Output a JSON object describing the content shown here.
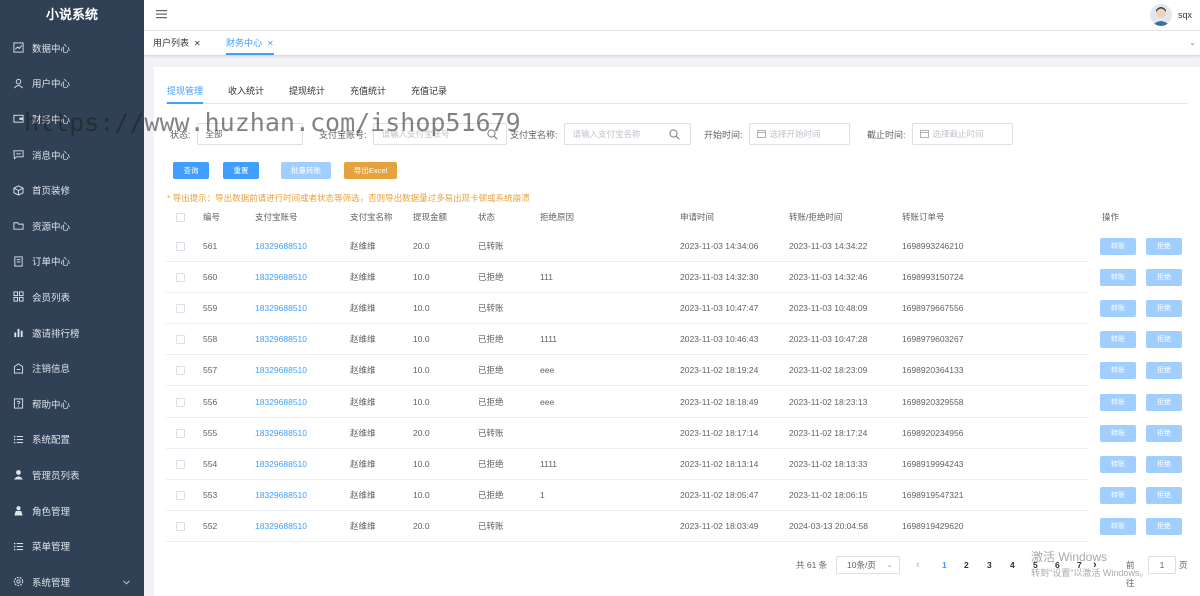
{
  "app_title": "小说系统",
  "sidebar": {
    "items": [
      {
        "label": "数据中心",
        "icon": "chart-icon"
      },
      {
        "label": "用户中心",
        "icon": "user-icon"
      },
      {
        "label": "财务中心",
        "icon": "wallet-icon"
      },
      {
        "label": "消息中心",
        "icon": "message-icon"
      },
      {
        "label": "首页装修",
        "icon": "cube-icon"
      },
      {
        "label": "资源中心",
        "icon": "folder-icon"
      },
      {
        "label": "订单中心",
        "icon": "order-icon"
      },
      {
        "label": "会员列表",
        "icon": "grid-icon"
      },
      {
        "label": "邀请排行榜",
        "icon": "bar-chart-icon"
      },
      {
        "label": "注销信息",
        "icon": "logout-icon"
      },
      {
        "label": "帮助中心",
        "icon": "help-icon"
      },
      {
        "label": "系统配置",
        "icon": "list-icon"
      },
      {
        "label": "管理员列表",
        "icon": "admin-icon"
      },
      {
        "label": "角色管理",
        "icon": "role-icon"
      },
      {
        "label": "菜单管理",
        "icon": "menu-icon"
      },
      {
        "label": "系统管理",
        "icon": "settings-icon"
      }
    ]
  },
  "header": {
    "username": "sqx"
  },
  "tags": [
    {
      "label": "用户列表",
      "active": false
    },
    {
      "label": "财务中心",
      "active": true
    }
  ],
  "tabs": [
    "提现管理",
    "收入统计",
    "提现统计",
    "充值统计",
    "充值记录"
  ],
  "filters": {
    "status_label": "状态:",
    "status_value": "全部",
    "account_label": "支付宝账号:",
    "account_placeholder": "请输入支付宝账号",
    "name_label": "支付宝名称:",
    "name_placeholder": "请输入支付宝名称",
    "start_label": "开始时间:",
    "start_placeholder": "选择开始时间",
    "end_label": "截止时间:",
    "end_placeholder": "选择截止时间"
  },
  "buttons": {
    "query": "查询",
    "reset": "重置",
    "batch": "批量转账",
    "export": "导出Excel"
  },
  "warning": "* 导出提示：导出数据前请进行时间或者状态等筛选，否则导出数据量过多易出现卡顿或系统崩溃",
  "table": {
    "headers": [
      "编号",
      "支付宝账号",
      "支付宝名称",
      "提现金额",
      "状态",
      "拒绝原因",
      "申请时间",
      "转账/拒绝时间",
      "转账订单号",
      "操作"
    ],
    "op_transfer": "转账",
    "op_reject": "拒绝",
    "rows": [
      [
        "561",
        "18329688510",
        "赵维维",
        "20.0",
        "已转账",
        "",
        "2023-11-03 14:34:06",
        "2023-11-03 14:34:22",
        "1698993246210"
      ],
      [
        "560",
        "18329688510",
        "赵维维",
        "10.0",
        "已拒绝",
        "111",
        "2023-11-03 14:32:30",
        "2023-11-03 14:32:46",
        "1698993150724"
      ],
      [
        "559",
        "18329688510",
        "赵维维",
        "10.0",
        "已转账",
        "",
        "2023-11-03 10:47:47",
        "2023-11-03 10:48:09",
        "1698979667556"
      ],
      [
        "558",
        "18329688510",
        "赵维维",
        "10.0",
        "已拒绝",
        "1111",
        "2023-11-03 10:46:43",
        "2023-11-03 10:47:28",
        "1698979603267"
      ],
      [
        "557",
        "18329688510",
        "赵维维",
        "10.0",
        "已拒绝",
        "eee",
        "2023-11-02 18:19:24",
        "2023-11-02 18:23:09",
        "1698920364133"
      ],
      [
        "556",
        "18329688510",
        "赵维维",
        "10.0",
        "已拒绝",
        "eee",
        "2023-11-02 18:18:49",
        "2023-11-02 18:23:13",
        "1698920329558"
      ],
      [
        "555",
        "18329688510",
        "赵维维",
        "20.0",
        "已转账",
        "",
        "2023-11-02 18:17:14",
        "2023-11-02 18:17:24",
        "1698920234956"
      ],
      [
        "554",
        "18329688510",
        "赵维维",
        "10.0",
        "已拒绝",
        "1111",
        "2023-11-02 18:13:14",
        "2023-11-02 18:13:33",
        "1698919994243"
      ],
      [
        "553",
        "18329688510",
        "赵维维",
        "10.0",
        "已拒绝",
        "1",
        "2023-11-02 18:05:47",
        "2023-11-02 18:06:15",
        "1698919547321"
      ],
      [
        "552",
        "18329688510",
        "赵维维",
        "20.0",
        "已转账",
        "",
        "2023-11-02 18:03:49",
        "2024-03-13 20:04:58",
        "1698919429620"
      ]
    ]
  },
  "pagination": {
    "total": "共 61 条",
    "page_size": "10条/页",
    "prev": "‹",
    "pages": [
      "1",
      "2",
      "3",
      "4",
      "5",
      "6",
      "7"
    ],
    "current": "1",
    "next": "›",
    "goto_label": "前往",
    "goto_value": "1",
    "goto_suffix": "页"
  },
  "watermark": "https://www.huzhan.com/ishop51679",
  "windows_notice": {
    "line1": "激活 Windows",
    "line2": "转到\"设置\"以激活 Windows。"
  },
  "colors": {
    "sidebar_bg": "#304156",
    "primary": "#409eff",
    "warning": "#e6a23c",
    "disabled_primary": "#a0cfff"
  }
}
